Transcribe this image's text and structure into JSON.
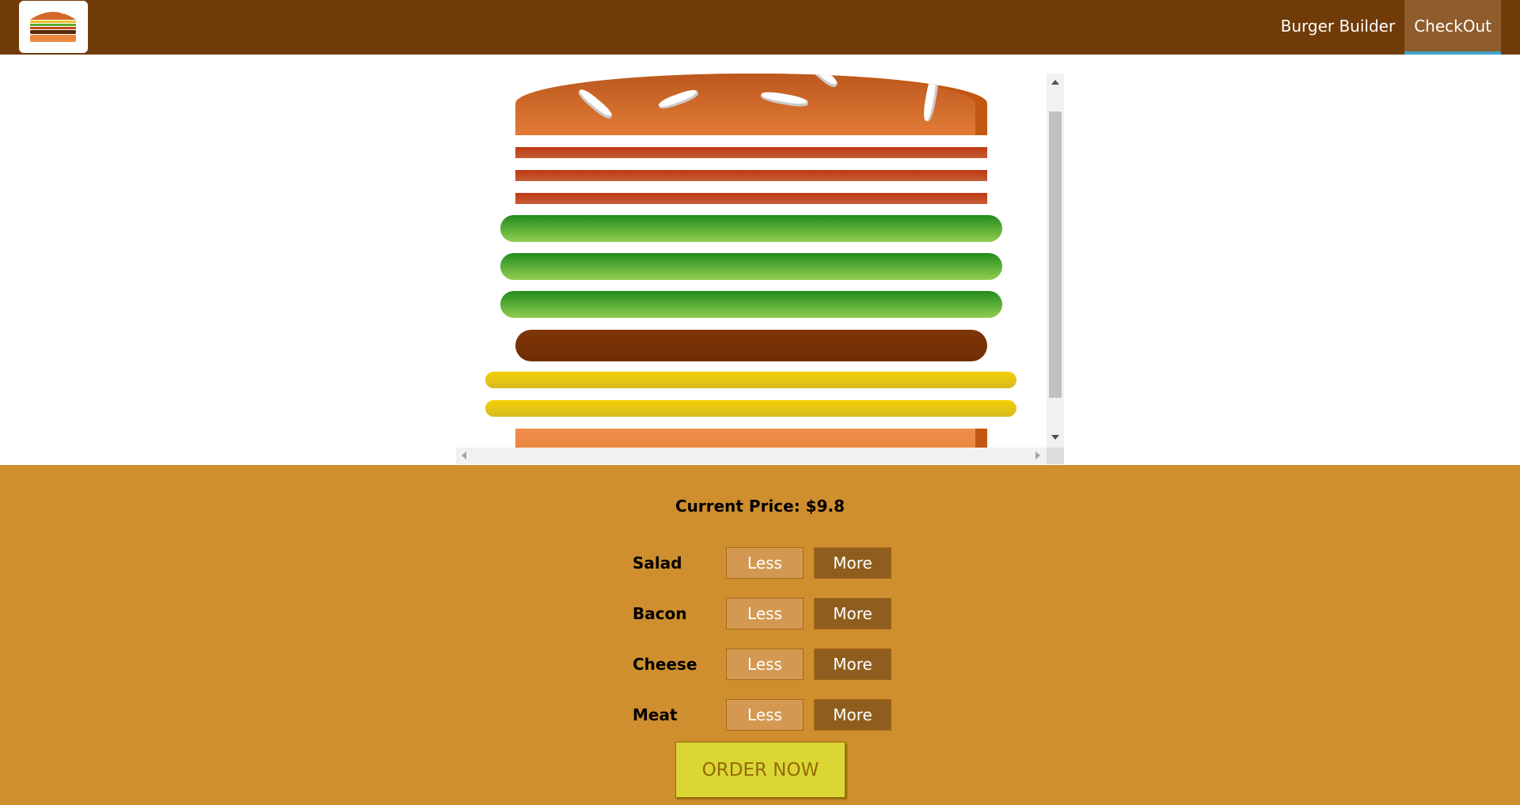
{
  "header": {
    "logo_alt": "burger-logo",
    "nav": [
      {
        "label": "Burger Builder",
        "active": false
      },
      {
        "label": "CheckOut",
        "active": true
      }
    ],
    "colors": {
      "background": "#703B09",
      "active": "#8F5C2C",
      "active_border": "#40A4C8"
    }
  },
  "burger": {
    "ingredients_visible": [
      "bread-top",
      "bacon",
      "bacon",
      "bacon",
      "salad",
      "salad",
      "salad",
      "meat",
      "cheese",
      "cheese",
      "bread-bottom"
    ]
  },
  "build_controls": {
    "price_label": "Current Price: $9.8",
    "controls": [
      {
        "label": "Salad",
        "less": "Less",
        "more": "More"
      },
      {
        "label": "Bacon",
        "less": "Less",
        "more": "More"
      },
      {
        "label": "Cheese",
        "less": "Less",
        "more": "More"
      },
      {
        "label": "Meat",
        "less": "Less",
        "more": "More"
      }
    ],
    "order_button": "ORDER NOW",
    "colors": {
      "background": "#CF8F2E",
      "less": "#D39952",
      "more": "#8F5E1E",
      "order": "#DAD735"
    }
  }
}
